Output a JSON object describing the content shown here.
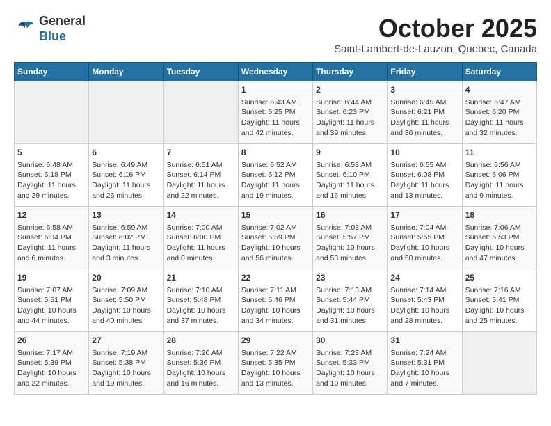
{
  "header": {
    "logo_line1": "General",
    "logo_line2": "Blue",
    "month": "October 2025",
    "location": "Saint-Lambert-de-Lauzon, Quebec, Canada"
  },
  "days_of_week": [
    "Sunday",
    "Monday",
    "Tuesday",
    "Wednesday",
    "Thursday",
    "Friday",
    "Saturday"
  ],
  "weeks": [
    [
      {
        "day": "",
        "info": ""
      },
      {
        "day": "",
        "info": ""
      },
      {
        "day": "",
        "info": ""
      },
      {
        "day": "1",
        "info": "Sunrise: 6:43 AM\nSunset: 6:25 PM\nDaylight: 11 hours\nand 42 minutes."
      },
      {
        "day": "2",
        "info": "Sunrise: 6:44 AM\nSunset: 6:23 PM\nDaylight: 11 hours\nand 39 minutes."
      },
      {
        "day": "3",
        "info": "Sunrise: 6:45 AM\nSunset: 6:21 PM\nDaylight: 11 hours\nand 36 minutes."
      },
      {
        "day": "4",
        "info": "Sunrise: 6:47 AM\nSunset: 6:20 PM\nDaylight: 11 hours\nand 32 minutes."
      }
    ],
    [
      {
        "day": "5",
        "info": "Sunrise: 6:48 AM\nSunset: 6:18 PM\nDaylight: 11 hours\nand 29 minutes."
      },
      {
        "day": "6",
        "info": "Sunrise: 6:49 AM\nSunset: 6:16 PM\nDaylight: 11 hours\nand 26 minutes."
      },
      {
        "day": "7",
        "info": "Sunrise: 6:51 AM\nSunset: 6:14 PM\nDaylight: 11 hours\nand 22 minutes."
      },
      {
        "day": "8",
        "info": "Sunrise: 6:52 AM\nSunset: 6:12 PM\nDaylight: 11 hours\nand 19 minutes."
      },
      {
        "day": "9",
        "info": "Sunrise: 6:53 AM\nSunset: 6:10 PM\nDaylight: 11 hours\nand 16 minutes."
      },
      {
        "day": "10",
        "info": "Sunrise: 6:55 AM\nSunset: 6:08 PM\nDaylight: 11 hours\nand 13 minutes."
      },
      {
        "day": "11",
        "info": "Sunrise: 6:56 AM\nSunset: 6:06 PM\nDaylight: 11 hours\nand 9 minutes."
      }
    ],
    [
      {
        "day": "12",
        "info": "Sunrise: 6:58 AM\nSunset: 6:04 PM\nDaylight: 11 hours\nand 6 minutes."
      },
      {
        "day": "13",
        "info": "Sunrise: 6:59 AM\nSunset: 6:02 PM\nDaylight: 11 hours\nand 3 minutes."
      },
      {
        "day": "14",
        "info": "Sunrise: 7:00 AM\nSunset: 6:00 PM\nDaylight: 11 hours\nand 0 minutes."
      },
      {
        "day": "15",
        "info": "Sunrise: 7:02 AM\nSunset: 5:59 PM\nDaylight: 10 hours\nand 56 minutes."
      },
      {
        "day": "16",
        "info": "Sunrise: 7:03 AM\nSunset: 5:57 PM\nDaylight: 10 hours\nand 53 minutes."
      },
      {
        "day": "17",
        "info": "Sunrise: 7:04 AM\nSunset: 5:55 PM\nDaylight: 10 hours\nand 50 minutes."
      },
      {
        "day": "18",
        "info": "Sunrise: 7:06 AM\nSunset: 5:53 PM\nDaylight: 10 hours\nand 47 minutes."
      }
    ],
    [
      {
        "day": "19",
        "info": "Sunrise: 7:07 AM\nSunset: 5:51 PM\nDaylight: 10 hours\nand 44 minutes."
      },
      {
        "day": "20",
        "info": "Sunrise: 7:09 AM\nSunset: 5:50 PM\nDaylight: 10 hours\nand 40 minutes."
      },
      {
        "day": "21",
        "info": "Sunrise: 7:10 AM\nSunset: 5:48 PM\nDaylight: 10 hours\nand 37 minutes."
      },
      {
        "day": "22",
        "info": "Sunrise: 7:11 AM\nSunset: 5:46 PM\nDaylight: 10 hours\nand 34 minutes."
      },
      {
        "day": "23",
        "info": "Sunrise: 7:13 AM\nSunset: 5:44 PM\nDaylight: 10 hours\nand 31 minutes."
      },
      {
        "day": "24",
        "info": "Sunrise: 7:14 AM\nSunset: 5:43 PM\nDaylight: 10 hours\nand 28 minutes."
      },
      {
        "day": "25",
        "info": "Sunrise: 7:16 AM\nSunset: 5:41 PM\nDaylight: 10 hours\nand 25 minutes."
      }
    ],
    [
      {
        "day": "26",
        "info": "Sunrise: 7:17 AM\nSunset: 5:39 PM\nDaylight: 10 hours\nand 22 minutes."
      },
      {
        "day": "27",
        "info": "Sunrise: 7:19 AM\nSunset: 5:38 PM\nDaylight: 10 hours\nand 19 minutes."
      },
      {
        "day": "28",
        "info": "Sunrise: 7:20 AM\nSunset: 5:36 PM\nDaylight: 10 hours\nand 16 minutes."
      },
      {
        "day": "29",
        "info": "Sunrise: 7:22 AM\nSunset: 5:35 PM\nDaylight: 10 hours\nand 13 minutes."
      },
      {
        "day": "30",
        "info": "Sunrise: 7:23 AM\nSunset: 5:33 PM\nDaylight: 10 hours\nand 10 minutes."
      },
      {
        "day": "31",
        "info": "Sunrise: 7:24 AM\nSunset: 5:31 PM\nDaylight: 10 hours\nand 7 minutes."
      },
      {
        "day": "",
        "info": ""
      }
    ]
  ]
}
